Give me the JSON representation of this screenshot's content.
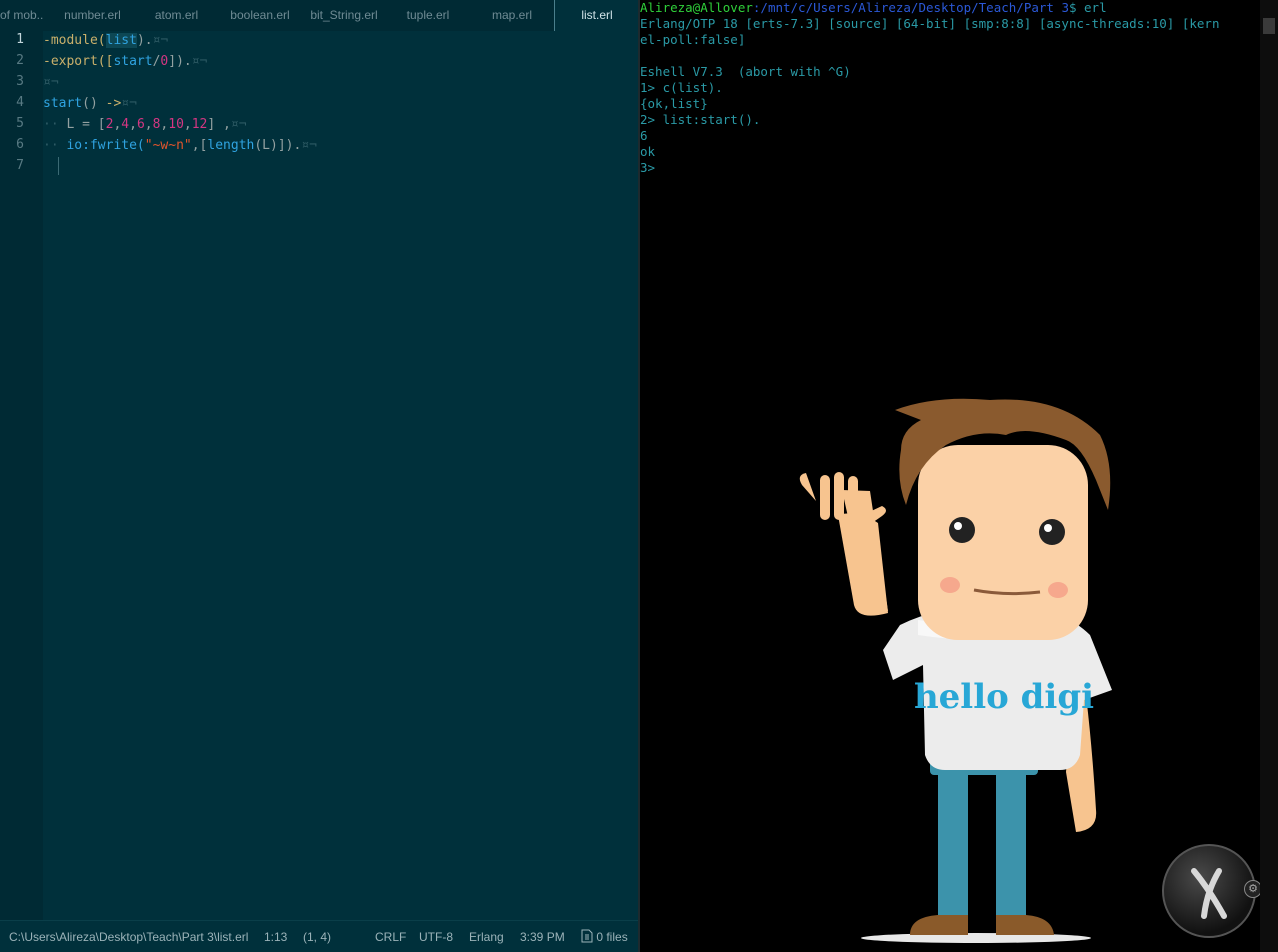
{
  "editor": {
    "tabs": [
      {
        "label": "of mob..."
      },
      {
        "label": "number.erl"
      },
      {
        "label": "atom.erl"
      },
      {
        "label": "boolean.erl"
      },
      {
        "label": "bit_String.erl"
      },
      {
        "label": "tuple.erl"
      },
      {
        "label": "map.erl"
      },
      {
        "label": "list.erl"
      }
    ],
    "active_tab": "list.erl",
    "line_numbers": [
      "1",
      "2",
      "3",
      "4",
      "5",
      "6",
      "7"
    ],
    "code": {
      "l1": {
        "a": "-module(",
        "b": "list",
        "c": ").",
        "eol": "¤¬"
      },
      "l2": {
        "a": "-export([",
        "b": "start",
        "c": "/",
        "d": "0",
        "e": "]).",
        "eol": "¤¬"
      },
      "l3": {
        "eol": "¤¬"
      },
      "l4": {
        "a": "start",
        "b": "() ",
        "c": "->",
        "eol": "¤¬"
      },
      "l5": {
        "ind": "··",
        "a": "L = [",
        "n1": "2",
        "n2": "4",
        "n3": "6",
        "n4": "8",
        "n5": "10",
        "n6": "12",
        "b": "] ,",
        "eol": "¤¬"
      },
      "l6": {
        "ind": "··",
        "a": "io:fwrite(",
        "s": "\"~w~n\"",
        "b": ",[",
        "c": "length",
        "d": "(L)]).",
        "eol": "¤¬"
      }
    },
    "status": {
      "path": "C:\\Users\\Alireza\\Desktop\\Teach\\Part 3\\list.erl",
      "position": "1:13",
      "selection": "(1, 4)",
      "line_ending": "CRLF",
      "encoding": "UTF-8",
      "grammar": "Erlang",
      "clock": "3:39 PM",
      "files": "0 files"
    }
  },
  "terminal": {
    "prompt_user": "Alireza@Allover",
    "prompt_path": ":/mnt/c/Users/Alireza/Desktop/Teach/Part 3",
    "prompt_cmd": "$ erl",
    "lines": [
      "Erlang/OTP 18 [erts-7.3] [source] [64-bit] [smp:8:8] [async-threads:10] [kern",
      "el-poll:false]",
      "",
      "Eshell V7.3  (abort with ^G)",
      "1> c(list).",
      "{ok,list}",
      "2> list:start().",
      "6",
      "ok",
      "3>"
    ],
    "shirt_text": "hello digi"
  },
  "colors": {
    "editor_bg": "#00303b",
    "terminal_bg": "#000000",
    "terminal_text": "#2a9aa6",
    "prompt_user": "#2fd03a",
    "prompt_path": "#2b58d6"
  }
}
